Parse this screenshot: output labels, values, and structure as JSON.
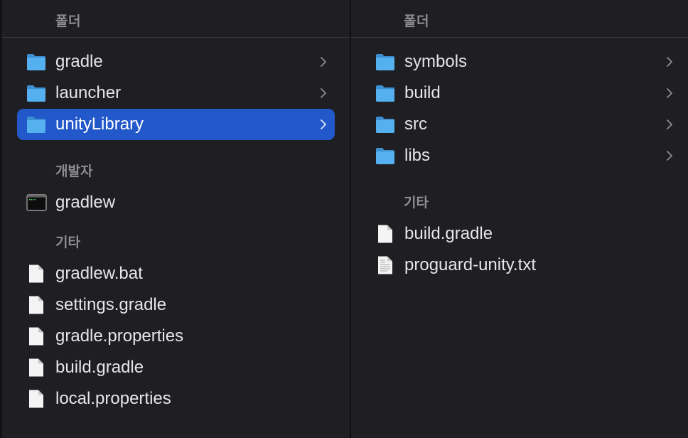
{
  "colors": {
    "background": "#1f1e22",
    "selection": "#2258c9",
    "folder": "#4aa6ec",
    "secondary_text": "#8d8d92",
    "primary_text": "#e6e6e8"
  },
  "columns": [
    {
      "header": "폴더",
      "folders": [
        {
          "name": "gradle",
          "icon": "folder-icon",
          "selected": false
        },
        {
          "name": "launcher",
          "icon": "folder-icon",
          "selected": false
        },
        {
          "name": "unityLibrary",
          "icon": "folder-icon",
          "selected": true
        }
      ],
      "sections": [
        {
          "label": "개발자",
          "items": [
            {
              "name": "gradlew",
              "icon": "terminal-icon"
            }
          ]
        },
        {
          "label": "기타",
          "items": [
            {
              "name": "gradlew.bat",
              "icon": "document-icon"
            },
            {
              "name": "settings.gradle",
              "icon": "document-icon"
            },
            {
              "name": "gradle.properties",
              "icon": "document-icon"
            },
            {
              "name": "build.gradle",
              "icon": "document-icon"
            },
            {
              "name": "local.properties",
              "icon": "document-icon"
            }
          ]
        }
      ]
    },
    {
      "header": "폴더",
      "folders": [
        {
          "name": "symbols",
          "icon": "folder-icon",
          "selected": false
        },
        {
          "name": "build",
          "icon": "folder-icon",
          "selected": false
        },
        {
          "name": "src",
          "icon": "folder-icon",
          "selected": false
        },
        {
          "name": "libs",
          "icon": "folder-icon",
          "selected": false
        }
      ],
      "sections": [
        {
          "label": "기타",
          "items": [
            {
              "name": "build.gradle",
              "icon": "document-icon"
            },
            {
              "name": "proguard-unity.txt",
              "icon": "text-document-icon"
            }
          ]
        }
      ]
    }
  ]
}
